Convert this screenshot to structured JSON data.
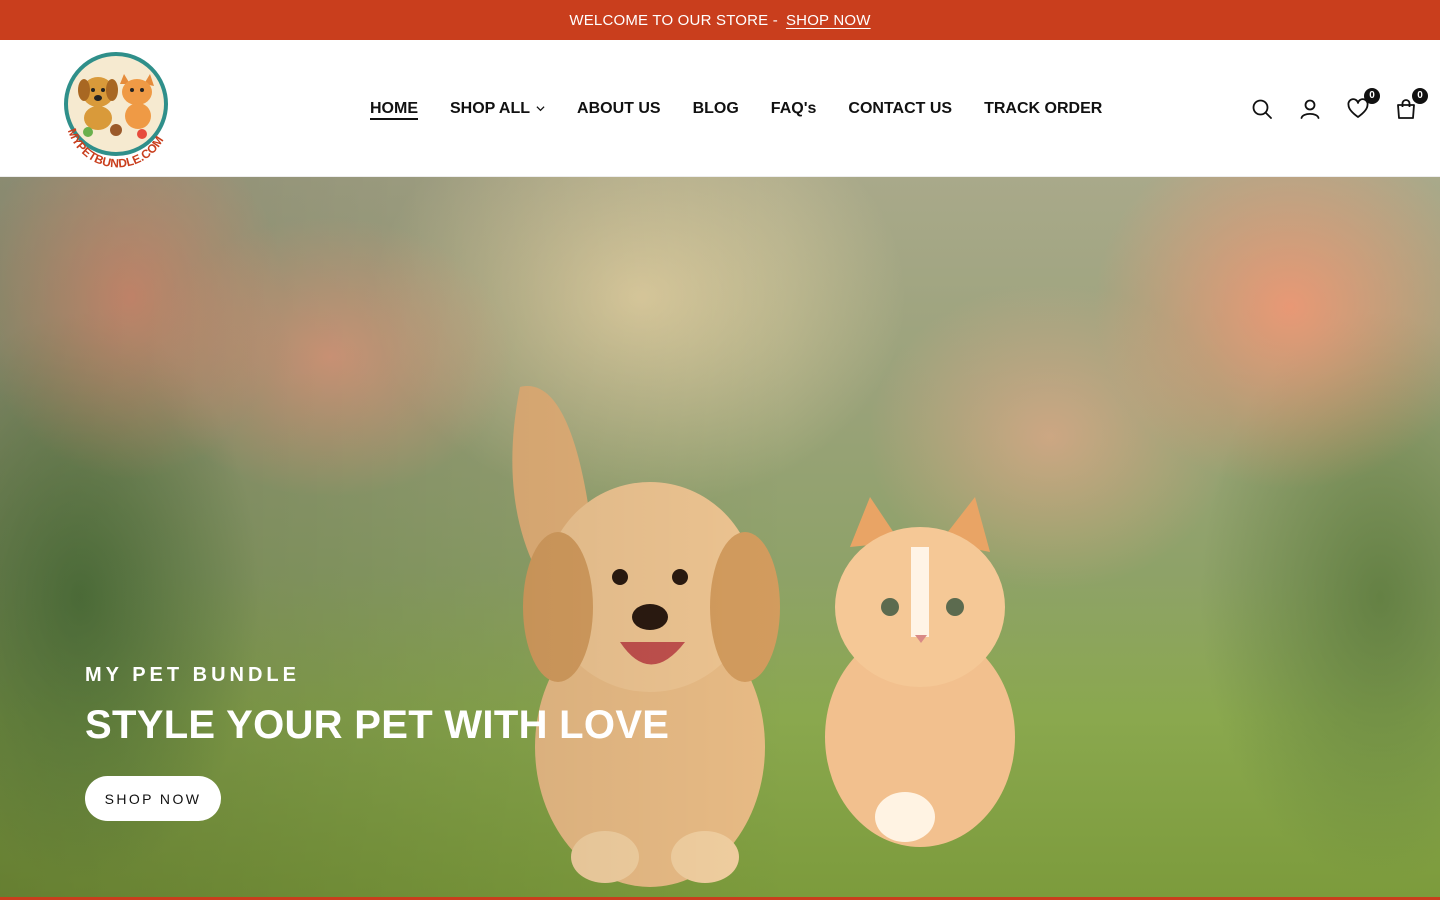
{
  "announcement": {
    "text": "WELCOME TO OUR STORE -",
    "link_label": "SHOP NOW"
  },
  "header": {
    "logo_text": "MYPETBUNDLE.COM",
    "nav": [
      {
        "label": "HOME",
        "active": true
      },
      {
        "label": "SHOP ALL",
        "has_dropdown": true
      },
      {
        "label": "ABOUT US"
      },
      {
        "label": "BLOG"
      },
      {
        "label": "FAQ's"
      },
      {
        "label": "CONTACT US"
      },
      {
        "label": "TRACK ORDER"
      }
    ],
    "icons": {
      "search": "search-icon",
      "account": "user-icon",
      "wishlist": "heart-icon",
      "cart": "shopping-bag-icon"
    },
    "wishlist_count": "0",
    "cart_count": "0"
  },
  "hero": {
    "subtitle": "MY PET BUNDLE",
    "title": "STYLE YOUR PET WITH LOVE",
    "button_label": "SHOP NOW"
  },
  "colors": {
    "brand": "#c93e1d",
    "text": "#111111",
    "white": "#ffffff"
  }
}
